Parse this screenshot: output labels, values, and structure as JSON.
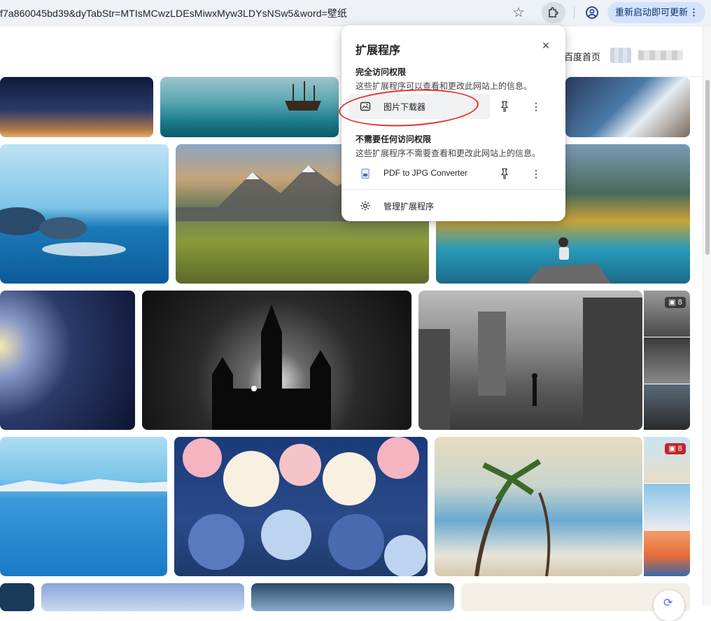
{
  "browser": {
    "url_text": "f7a860045bd39&dyTabStr=MTIsMCwzLDEsMiwxMyw3LDYsNSw5&word=壁纸",
    "update_button_label": "重新启动即可更新",
    "update_menu_glyph": "⋮"
  },
  "header": {
    "home_link": "百度首页"
  },
  "gallery": {
    "badges": [
      "8",
      "8"
    ]
  },
  "extensions_popup": {
    "title": "扩展程序",
    "close_glyph": "×",
    "full_access": {
      "title": "完全访问权限",
      "description": "这些扩展程序可以查看和更改此网站上的信息。",
      "items": [
        {
          "name": "图片下载器"
        }
      ]
    },
    "no_access": {
      "title": "不需要任何访问权限",
      "description": "这些扩展程序不需要查看和更改此网站上的信息。",
      "items": [
        {
          "name": "PDF to JPG Converter"
        }
      ]
    },
    "manage_label": "管理扩展程序",
    "more_glyph": "⋮"
  }
}
